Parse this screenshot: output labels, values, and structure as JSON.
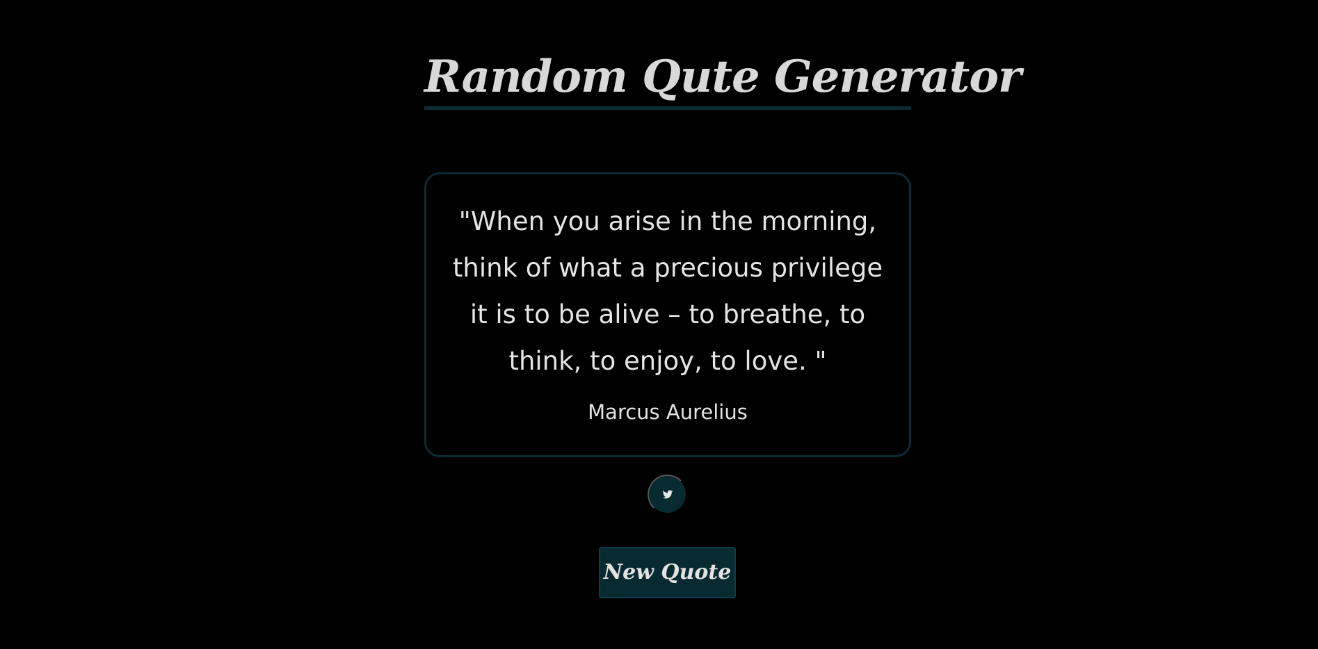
{
  "header": {
    "title": "Random Qute Generator"
  },
  "quote": {
    "text": "\"When you arise in the morning, think of what a precious privilege it is to be alive – to breathe, to think, to enjoy, to love. \"",
    "author": "Marcus Aurelius"
  },
  "actions": {
    "tweet_icon": "twitter-icon",
    "new_quote_label": "New Quote"
  },
  "colors": {
    "background": "#000000",
    "accent": "#082b31",
    "border": "#0b2c33",
    "text": "#e4e4e4"
  }
}
